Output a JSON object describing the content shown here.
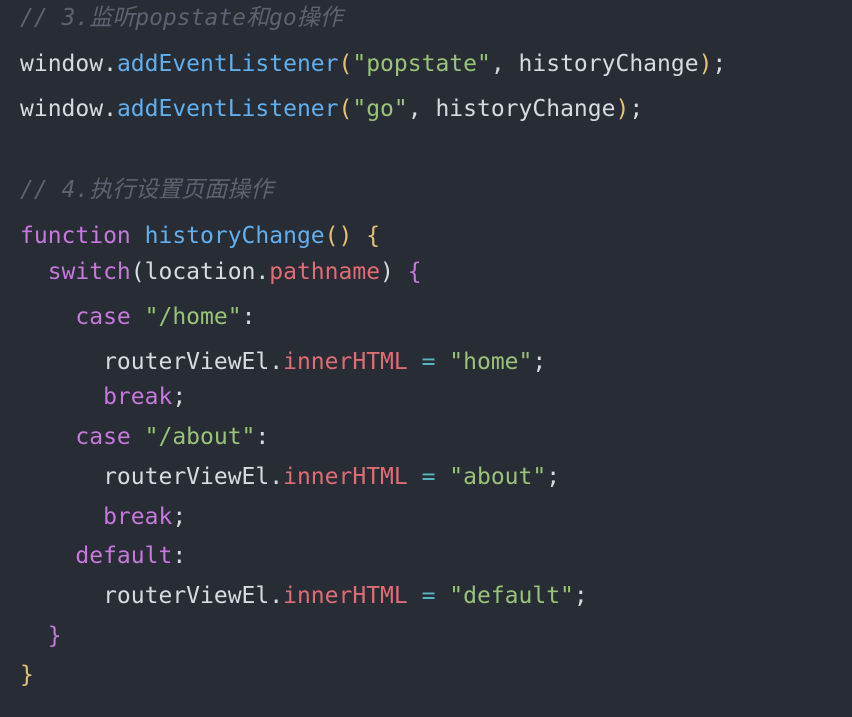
{
  "code": {
    "lines": [
      {
        "tokens": [
          {
            "text": "// 3.监听popstate和go操作",
            "type": "comment"
          }
        ]
      },
      {
        "tokens": [
          {
            "text": "window.",
            "type": "default"
          },
          {
            "text": "addEventListener",
            "type": "func"
          },
          {
            "text": "(",
            "type": "brace"
          },
          {
            "text": "\"popstate\"",
            "type": "str"
          },
          {
            "text": ", historyChange",
            "type": "default"
          },
          {
            "text": ")",
            "type": "brace"
          },
          {
            "text": ";",
            "type": "default"
          }
        ]
      },
      {
        "tokens": [
          {
            "text": "window.",
            "type": "default"
          },
          {
            "text": "addEventListener",
            "type": "func"
          },
          {
            "text": "(",
            "type": "brace"
          },
          {
            "text": "\"go\"",
            "type": "str"
          },
          {
            "text": ", historyChange",
            "type": "default"
          },
          {
            "text": ")",
            "type": "brace"
          },
          {
            "text": ";",
            "type": "default"
          }
        ]
      },
      {
        "tokens": []
      },
      {
        "tokens": [
          {
            "text": "// 4.执行设置页面操作",
            "type": "comment"
          }
        ]
      },
      {
        "tokens": [
          {
            "text": "function ",
            "type": "kw"
          },
          {
            "text": "historyChange",
            "type": "func"
          },
          {
            "text": "() ",
            "type": "brace"
          },
          {
            "text": "{",
            "type": "brace"
          }
        ]
      },
      {
        "tokens": [
          {
            "text": "  switch",
            "type": "kw"
          },
          {
            "text": "(",
            "type": "default"
          },
          {
            "text": "location.",
            "type": "default"
          },
          {
            "text": "pathname",
            "type": "prop"
          },
          {
            "text": ") ",
            "type": "default"
          },
          {
            "text": "{",
            "type": "kw"
          }
        ]
      },
      {
        "tokens": [
          {
            "text": "    case ",
            "type": "kw"
          },
          {
            "text": "\"/home\"",
            "type": "str"
          },
          {
            "text": ":",
            "type": "default"
          }
        ]
      },
      {
        "tokens": [
          {
            "text": "      routerViewEl.",
            "type": "default"
          },
          {
            "text": "innerHTML",
            "type": "prop"
          },
          {
            "text": " = ",
            "type": "op"
          },
          {
            "text": "\"home\"",
            "type": "str"
          },
          {
            "text": ";",
            "type": "default"
          }
        ]
      },
      {
        "tokens": [
          {
            "text": "      break",
            "type": "kw"
          },
          {
            "text": ";",
            "type": "default"
          }
        ]
      },
      {
        "tokens": [
          {
            "text": "    case ",
            "type": "kw"
          },
          {
            "text": "\"/about\"",
            "type": "str"
          },
          {
            "text": ":",
            "type": "default"
          }
        ]
      },
      {
        "tokens": [
          {
            "text": "      routerViewEl.",
            "type": "default"
          },
          {
            "text": "innerHTML",
            "type": "prop"
          },
          {
            "text": " = ",
            "type": "op"
          },
          {
            "text": "\"about\"",
            "type": "str"
          },
          {
            "text": ";",
            "type": "default"
          }
        ]
      },
      {
        "tokens": [
          {
            "text": "      break",
            "type": "kw"
          },
          {
            "text": ";",
            "type": "default"
          }
        ]
      },
      {
        "tokens": [
          {
            "text": "    default",
            "type": "kw"
          },
          {
            "text": ":",
            "type": "default"
          }
        ]
      },
      {
        "tokens": [
          {
            "text": "      routerViewEl.",
            "type": "default"
          },
          {
            "text": "innerHTML",
            "type": "prop"
          },
          {
            "text": " = ",
            "type": "op"
          },
          {
            "text": "\"default\"",
            "type": "str"
          },
          {
            "text": ";",
            "type": "default"
          }
        ]
      },
      {
        "tokens": [
          {
            "text": "  }",
            "type": "kw"
          }
        ]
      },
      {
        "tokens": [
          {
            "text": "}",
            "type": "brace"
          }
        ]
      }
    ]
  }
}
